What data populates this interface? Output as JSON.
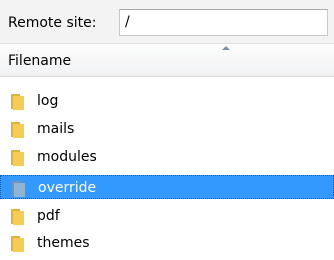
{
  "remote_site": {
    "label": "Remote site:",
    "path": "/"
  },
  "file_list": {
    "header": "Filename",
    "rows": [
      {
        "name": "log",
        "selected": false
      },
      {
        "name": "mails",
        "selected": false
      },
      {
        "name": "modules",
        "selected": false
      },
      {
        "name": "override",
        "selected": true
      },
      {
        "name": "pdf",
        "selected": false
      },
      {
        "name": "themes",
        "selected": false
      }
    ]
  },
  "colors": {
    "selection": "#3399ff",
    "folder": "#f0c040"
  },
  "icons": {
    "folder": "folder-icon",
    "sort": "sort-ascending-icon"
  }
}
